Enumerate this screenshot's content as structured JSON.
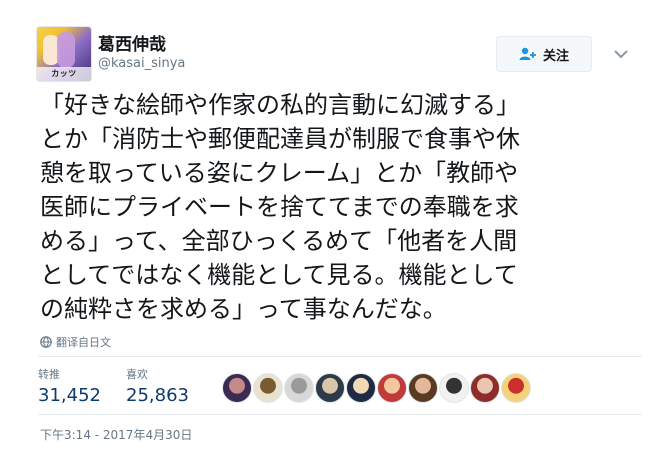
{
  "user": {
    "display_name": "葛西伸哉",
    "handle": "@kasai_sinya",
    "avatar_caption": "カッツ"
  },
  "follow_button": {
    "label": "关注",
    "icon": "add-user-icon"
  },
  "tweet": {
    "lines": [
      "「好きな絵師や作家の私的言動に幻滅する」",
      "とか「消防士や郵便配達員が制服で食事や休",
      "憩を取っている姿にクレーム」とか「教師や",
      "医師にプライベートを捨ててまでの奉職を求",
      "める」って、全部ひっくるめて「他者を人間",
      "としてではなく機能として見る。機能として",
      "の純粋さを求める」って事なんだな。"
    ]
  },
  "translate_label": "翻译自日文",
  "stats": {
    "retweets_label": "转推",
    "retweets_value": "31,452",
    "likes_label": "喜欢",
    "likes_value": "25,863"
  },
  "likers": [
    {
      "colors": [
        "#3b2a52",
        "#c48a8a"
      ]
    },
    {
      "colors": [
        "#e8e2d0",
        "#7a5a30"
      ]
    },
    {
      "colors": [
        "#d8d8d8",
        "#9a9a9a"
      ]
    },
    {
      "colors": [
        "#2c3a4a",
        "#d9c6a8"
      ]
    },
    {
      "colors": [
        "#1f2a44",
        "#f0d9b5"
      ]
    },
    {
      "colors": [
        "#c23b3b",
        "#f4c7a1"
      ]
    },
    {
      "colors": [
        "#5a3a22",
        "#e2b79a"
      ]
    },
    {
      "colors": [
        "#f1f1f1",
        "#333333"
      ]
    },
    {
      "colors": [
        "#8f2d2d",
        "#e8c6b0"
      ]
    },
    {
      "colors": [
        "#f3d27a",
        "#c9302c"
      ]
    }
  ],
  "timestamp": "下午3:14 - 2017年4月30日",
  "colors": {
    "stat_value": "#0f3b6b",
    "muted": "#657786",
    "divider": "#e6ecf0"
  }
}
